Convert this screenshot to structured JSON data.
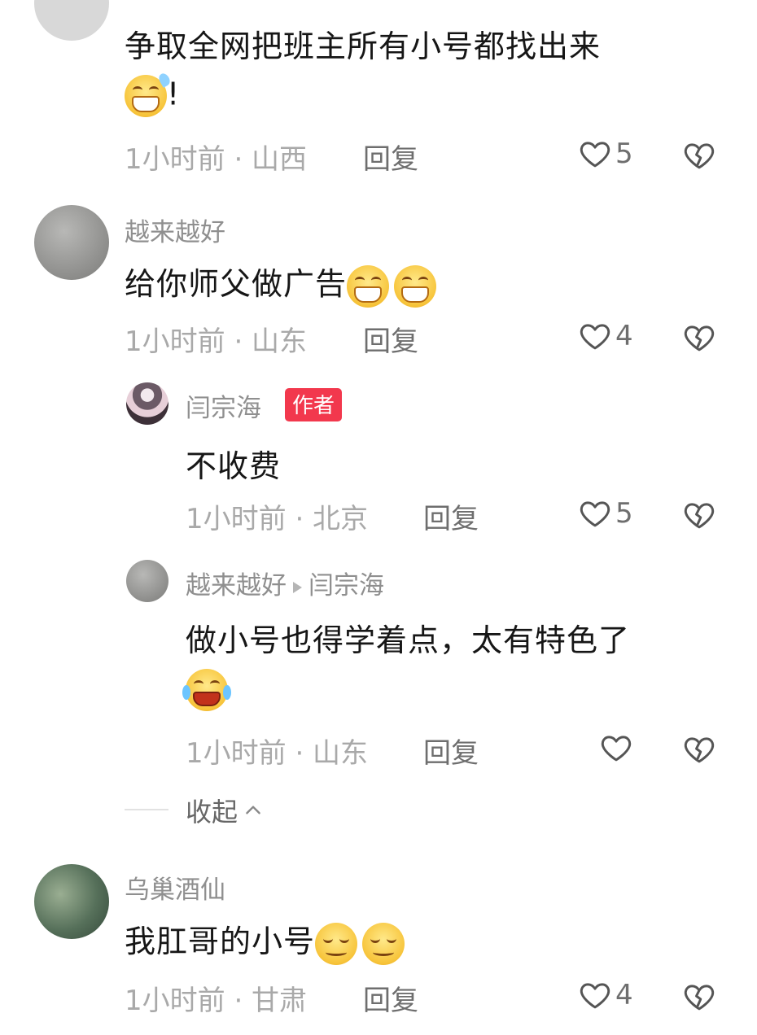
{
  "comments": [
    {
      "username": "",
      "text": "争取全网把班主所有小号都找出来",
      "text_suffix": "!",
      "emojis": [
        "grin-sweat-emoji"
      ],
      "time": "1小时前 · 山西",
      "reply_label": "回复",
      "likes": "5"
    },
    {
      "username": "越来越好",
      "text": "给你师父做广告",
      "emojis": [
        "grin-emoji",
        "grin-emoji"
      ],
      "time": "1小时前 · 山东",
      "reply_label": "回复",
      "likes": "4",
      "replies": [
        {
          "username": "闫宗海",
          "badge": "作者",
          "text": "不收费",
          "time": "1小时前 · 北京",
          "reply_label": "回复",
          "likes": "5"
        },
        {
          "username": "越来越好",
          "reply_to": "闫宗海",
          "text": "做小号也得学着点，太有特色了",
          "emojis": [
            "laugh-cry-emoji"
          ],
          "time": "1小时前 · 山东",
          "reply_label": "回复",
          "likes": ""
        }
      ],
      "collapse_label": "收起"
    },
    {
      "username": "乌巢酒仙",
      "text": "我肛哥的小号",
      "emojis": [
        "sly-smile-emoji",
        "sly-smile-emoji"
      ],
      "time": "1小时前 · 甘肃",
      "reply_label": "回复",
      "likes": "4"
    }
  ],
  "colors": {
    "badge": "#f2384d",
    "meta_text": "#a9a9a9",
    "username": "#8f8f8f",
    "body_text": "#161616"
  }
}
